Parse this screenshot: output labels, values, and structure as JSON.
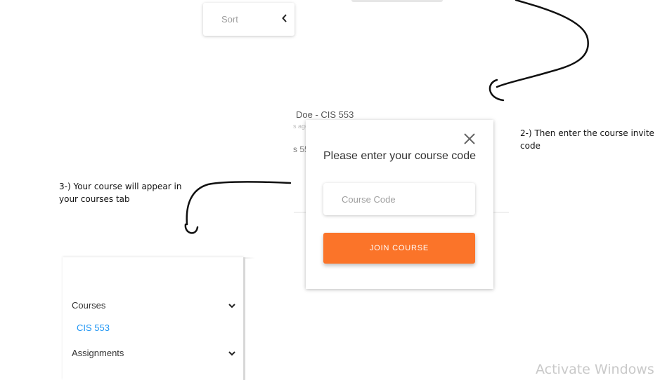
{
  "sort": {
    "label": "Sort",
    "icon": "chevron-left-icon"
  },
  "background_post": {
    "author": "Doe  - CIS 553",
    "time": "s ago",
    "course": "s 55"
  },
  "dialog": {
    "title": "Please enter your course code",
    "input_placeholder": "Course Code",
    "input_value": "",
    "join_label": "JOIN COURSE",
    "close_icon": "close-icon",
    "accent_color": "#fb7429"
  },
  "annotations": {
    "step2": "2-) Then enter the course invite code",
    "step3": "3-) Your course will appear in your courses tab"
  },
  "sidebar": {
    "items": [
      {
        "label": "Courses",
        "icon": "chevron-down-icon"
      },
      {
        "label": "CIS 553",
        "link_color": "#2196f3"
      },
      {
        "label": "Assignments",
        "icon": "chevron-down-icon"
      }
    ]
  },
  "watermark": "Activate Windows"
}
